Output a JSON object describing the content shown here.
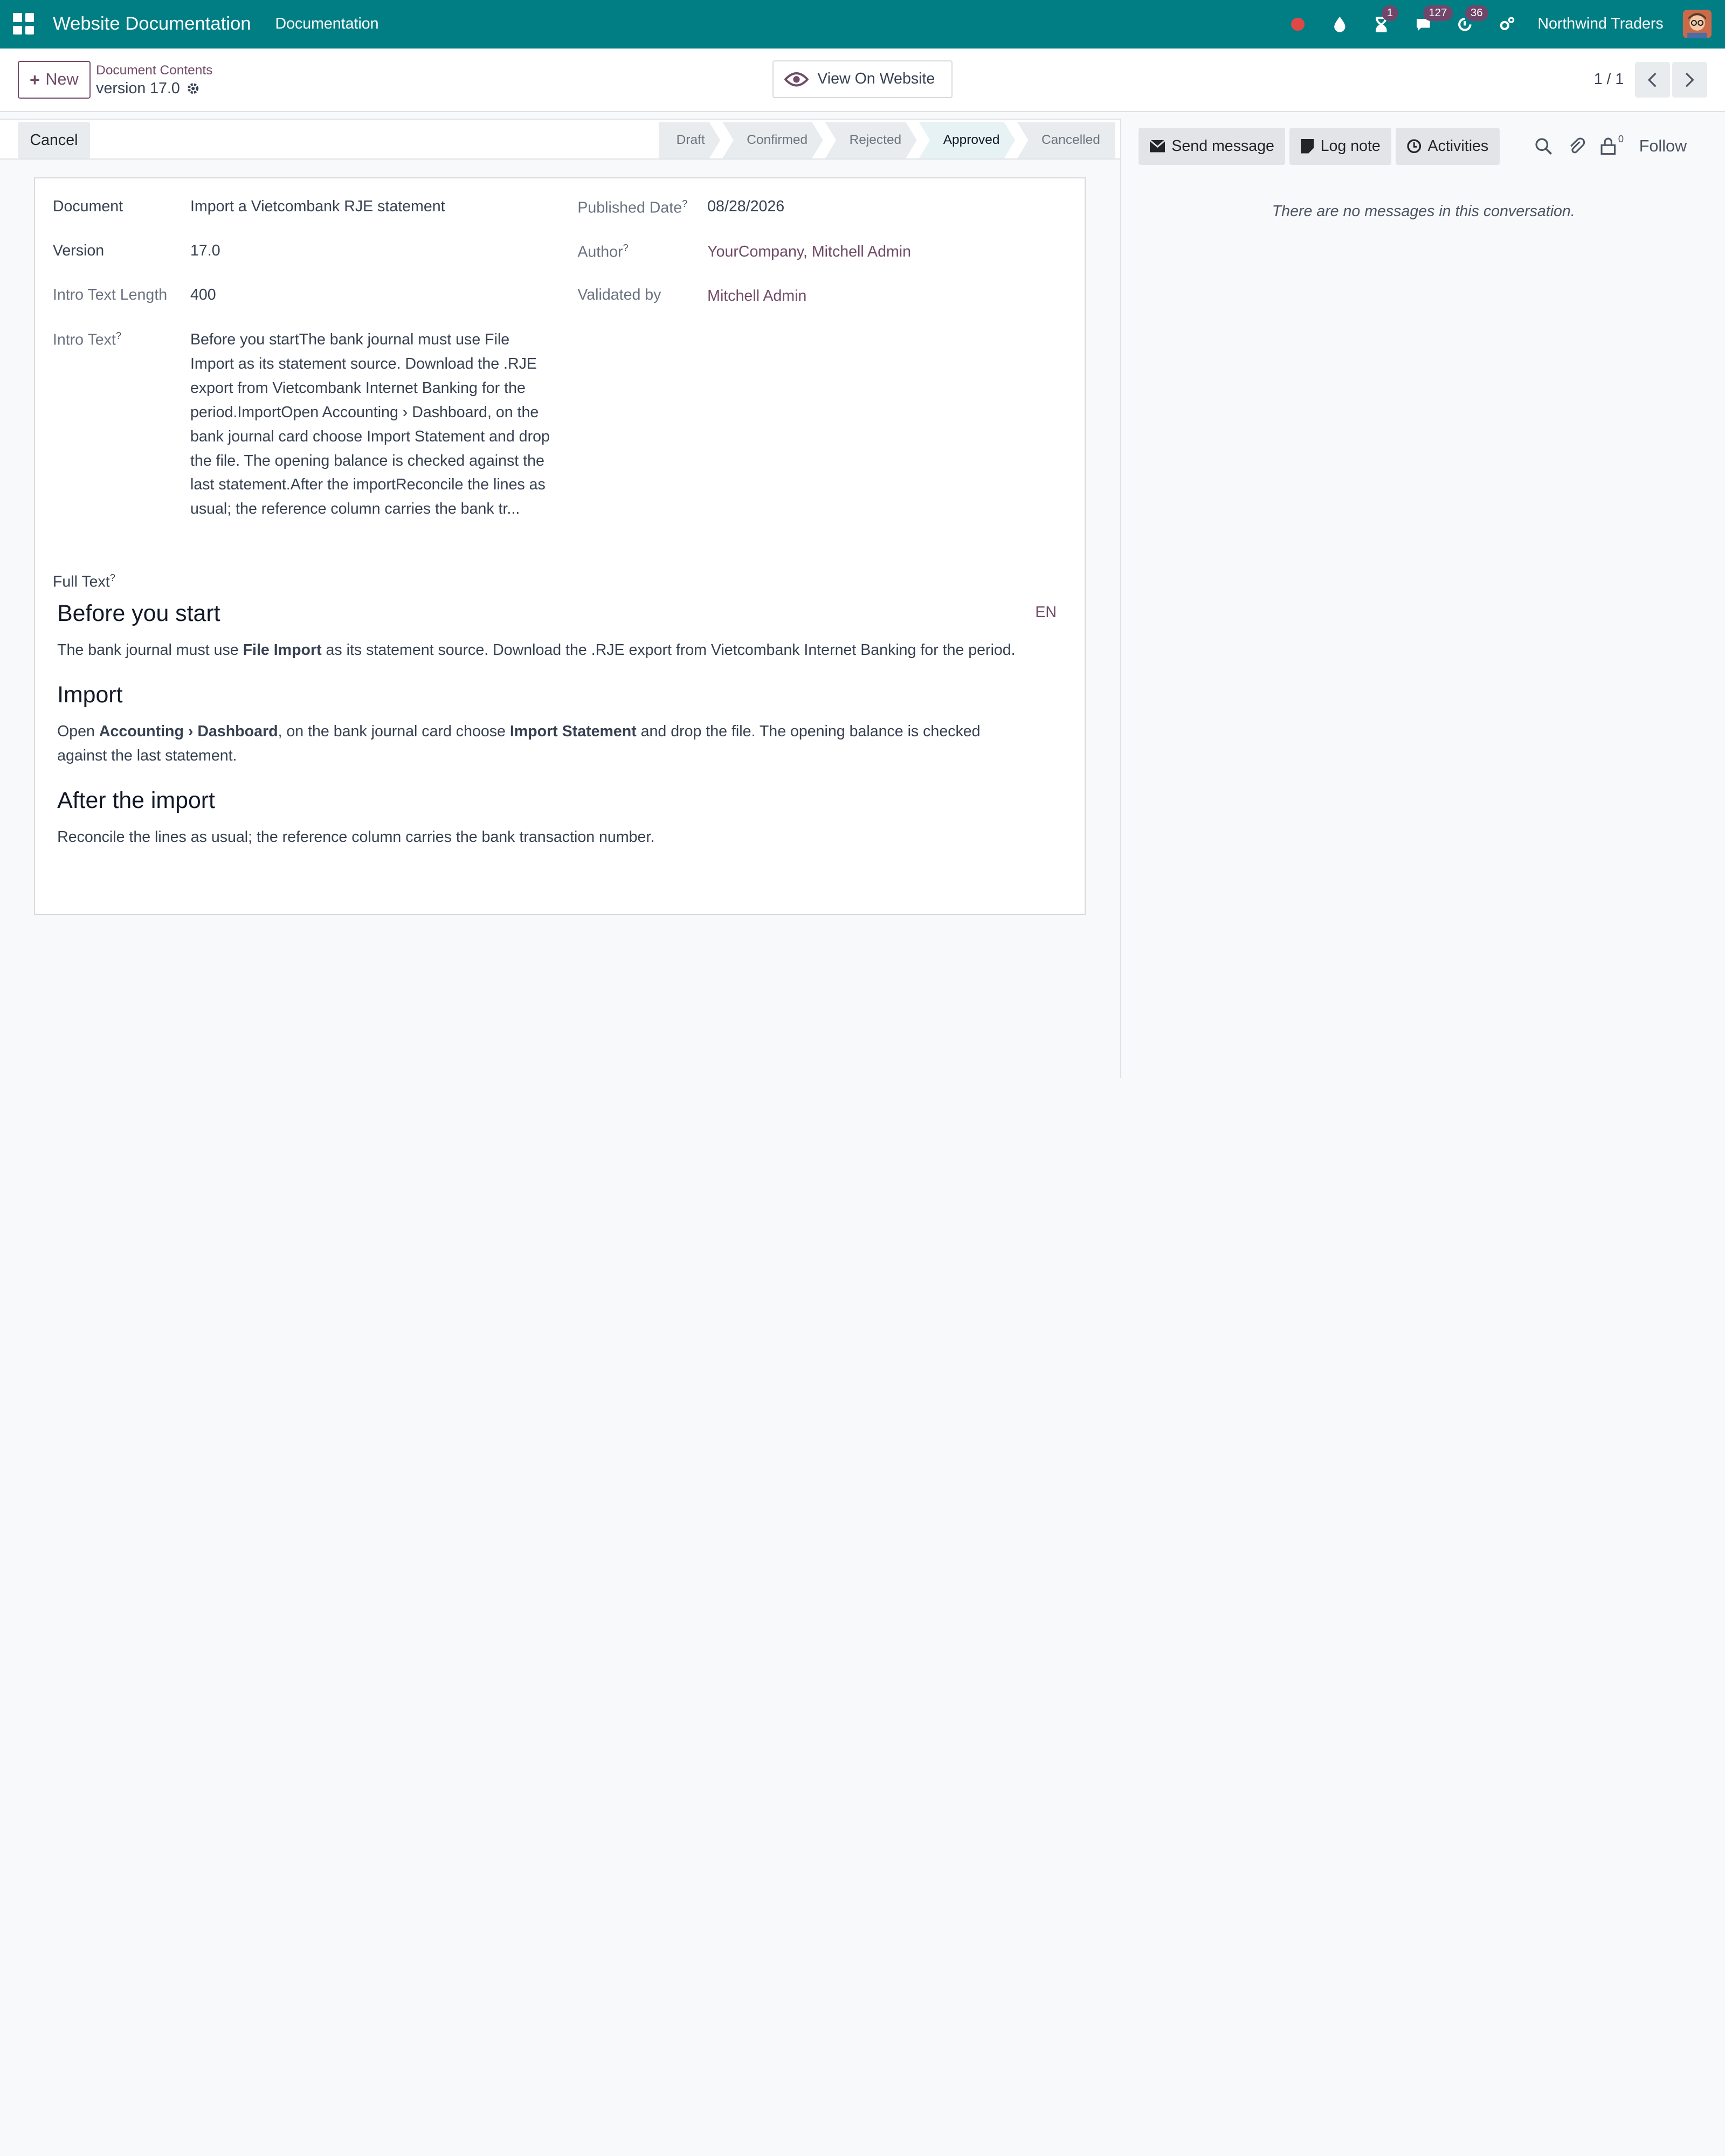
{
  "navbar": {
    "app_title": "Website Documentation",
    "menu_item": "Documentation",
    "activity_badge": "1",
    "messages_badge": "127",
    "timer_badge": "36",
    "company": "Northwind Traders"
  },
  "control": {
    "new_label": "New",
    "breadcrumb_parent": "Document Contents",
    "breadcrumb_current": "version 17.0",
    "view_website_label": "View On Website",
    "pager_value": "1 / 1"
  },
  "status": {
    "cancel_label": "Cancel",
    "stages": [
      "Draft",
      "Confirmed",
      "Rejected",
      "Approved",
      "Cancelled"
    ],
    "active_stage": "Approved"
  },
  "form": {
    "document_label": "Document",
    "document_value": "Import a Vietcombank RJE statement",
    "version_label": "Version",
    "version_value": "17.0",
    "intro_length_label": "Intro Text Length",
    "intro_length_value": "400",
    "intro_text_label": "Intro Text",
    "intro_text_value": "Before you startThe bank journal must use File Import as its statement source. Download the .RJE export from Vietcombank Internet Banking for the period.ImportOpen Accounting › Dashboard, on the bank journal card choose Import Statement and drop the file. The opening balance is checked against the last statement.After the importReconcile the lines as usual; the reference column carries the bank tr...",
    "published_label": "Published Date",
    "published_value": "08/28/2026",
    "author_label": "Author",
    "author_value": "YourCompany, Mitchell Admin",
    "validated_label": "Validated by",
    "validated_value": "Mitchell Admin",
    "full_text_label": "Full Text",
    "lang": "EN",
    "help_mark": "?"
  },
  "content": {
    "h1": "Before you start",
    "p1_a": "The bank journal must use ",
    "p1_b": "File Import",
    "p1_c": " as its statement source. Download the .RJE export from Vietcombank Internet Banking for the period.",
    "h2": "Import",
    "p2_a": "Open ",
    "p2_b": "Accounting › Dashboard",
    "p2_c": ", on the bank journal card choose ",
    "p2_d": "Import Statement",
    "p2_e": " and drop the file. The opening balance is checked against the last statement.",
    "h3": "After the import",
    "p3": "Reconcile the lines as usual; the reference column carries the bank transaction number."
  },
  "chatter": {
    "send_message": "Send message",
    "log_note": "Log note",
    "activities": "Activities",
    "follower_count": "0",
    "follow": "Follow",
    "empty_message": "There are no messages in this conversation."
  },
  "colors": {
    "navbar": "#017e84",
    "accent": "#714b67"
  }
}
